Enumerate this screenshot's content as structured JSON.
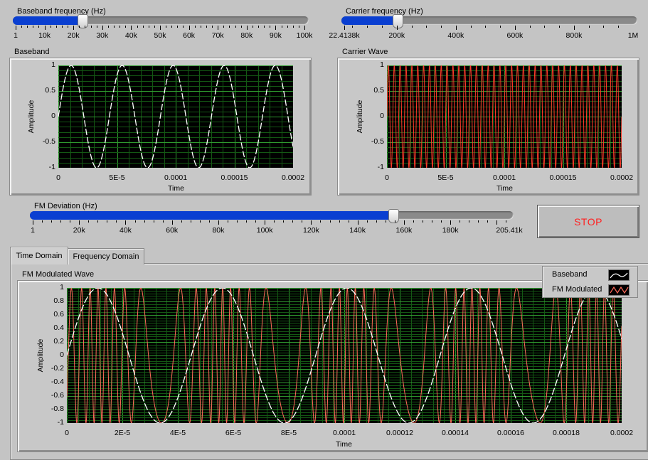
{
  "baseband_slider": {
    "label": "Baseband frequency (Hz)",
    "value_fraction": 0.23,
    "ticks": [
      "1",
      "10k",
      "20k",
      "30k",
      "40k",
      "50k",
      "60k",
      "70k",
      "80k",
      "90k",
      "100k"
    ]
  },
  "carrier_slider": {
    "label": "Carrier frequency (Hz)",
    "value_fraction": 0.07,
    "ticks": [
      "22.4138k",
      "200k",
      "400k",
      "600k",
      "800k",
      "1M"
    ]
  },
  "deviation_slider": {
    "label": "FM Deviation (Hz)",
    "value_fraction": 0.75,
    "ticks": [
      "1",
      "20k",
      "40k",
      "60k",
      "80k",
      "100k",
      "120k",
      "140k",
      "160k",
      "180k",
      "205.41k"
    ]
  },
  "baseband_graph": {
    "title": "Baseband",
    "xlabel": "Time",
    "ylabel": "Amplitude",
    "y_ticks": [
      "1",
      "0.5",
      "0",
      "-0.5",
      "-1"
    ],
    "x_ticks": [
      "0",
      "5E-5",
      "0.0001",
      "0.00015",
      "0.0002"
    ]
  },
  "carrier_graph": {
    "title": "Carrier Wave",
    "xlabel": "Time",
    "ylabel": "Amplitude",
    "y_ticks": [
      "1",
      "0.5",
      "0",
      "-0.5",
      "-1"
    ],
    "x_ticks": [
      "0",
      "5E-5",
      "0.0001",
      "0.00015",
      "0.0002"
    ]
  },
  "stop_button": {
    "label": "STOP",
    "color": "#ff2020"
  },
  "tabs": [
    {
      "label": "Time Domain",
      "active": true
    },
    {
      "label": "Frequency Domain",
      "active": false
    }
  ],
  "fm_graph": {
    "title": "FM Modulated Wave",
    "xlabel": "Time",
    "ylabel": "Amplitude",
    "y_ticks": [
      "1",
      "0.8",
      "0.6",
      "0.4",
      "0.2",
      "0",
      "-0.2",
      "-0.4",
      "-0.6",
      "-0.8",
      "-1"
    ],
    "x_ticks": [
      "0",
      "2E-5",
      "4E-5",
      "6E-5",
      "8E-5",
      "0.0001",
      "0.00012",
      "0.00014",
      "0.00016",
      "0.00018",
      "0.0002"
    ],
    "legend": [
      {
        "name": "Baseband",
        "color": "#ffffff"
      },
      {
        "name": "FM Modulated",
        "color": "#ff6a5a"
      }
    ]
  },
  "colors": {
    "plot_bg": "#000000",
    "grid": "#1c7a1c",
    "slider_fill": "#0a3fd1",
    "baseband_trace": "#ffffff",
    "carrier_trace": "#ff3a2a",
    "fm_trace": "#ff6a5a"
  },
  "chart_data": [
    {
      "type": "line",
      "title": "Baseband",
      "xlabel": "Time",
      "ylabel": "Amplitude",
      "xlim": [
        0,
        0.0002
      ],
      "ylim": [
        -1,
        1
      ],
      "series": [
        {
          "function": "sin(2*pi*23000*t)",
          "frequency_hz": 23000,
          "amplitude": 1
        }
      ]
    },
    {
      "type": "line",
      "title": "Carrier Wave",
      "xlabel": "Time",
      "ylabel": "Amplitude",
      "xlim": [
        0,
        0.0002
      ],
      "ylim": [
        -1,
        1
      ],
      "series": [
        {
          "function": "sin(2*pi*200000*t)",
          "frequency_hz": 200000,
          "amplitude": 1
        }
      ]
    },
    {
      "type": "line",
      "title": "FM Modulated Wave",
      "xlabel": "Time",
      "ylabel": "Amplitude",
      "xlim": [
        0,
        0.0002
      ],
      "ylim": [
        -1,
        1
      ],
      "series": [
        {
          "name": "Baseband",
          "function": "sin(2*pi*22300*t)",
          "frequency_hz": 22300
        },
        {
          "name": "FM Modulated",
          "carrier_hz": 200000,
          "deviation_hz": 155000,
          "baseband_hz": 22300
        }
      ]
    }
  ]
}
